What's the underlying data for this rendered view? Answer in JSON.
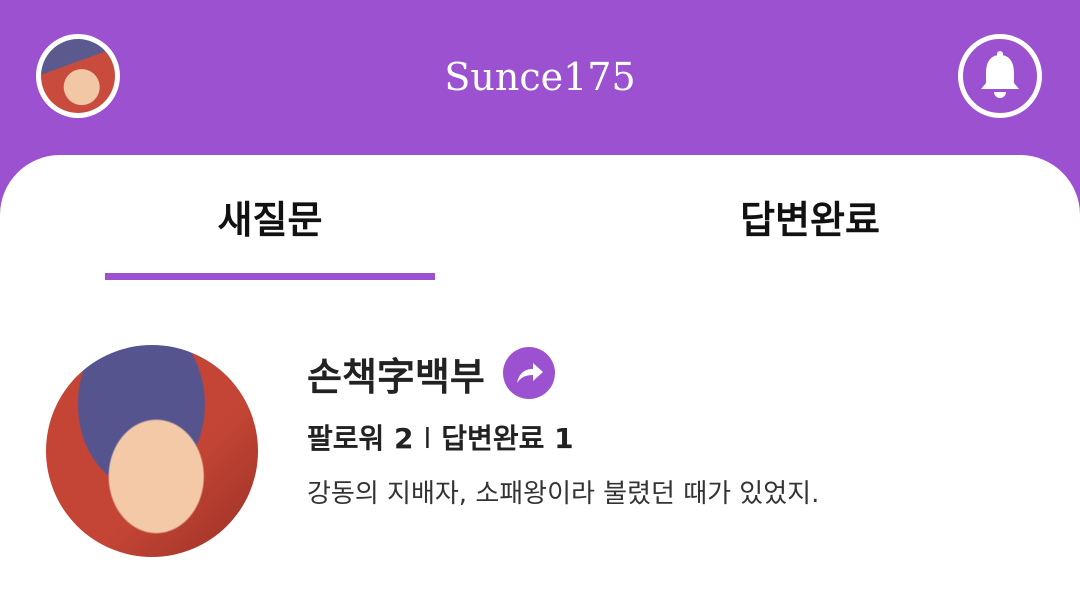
{
  "header": {
    "title": "Sunce175",
    "avatar_icon": "profile-thumbnail",
    "bell_icon": "bell-icon"
  },
  "colors": {
    "accent": "#9b51d0",
    "background": "#ffffff",
    "text": "#222222"
  },
  "tabs": [
    {
      "label": "새질문",
      "active": true
    },
    {
      "label": "답변완료",
      "active": false
    }
  ],
  "profile": {
    "name": "손책字백부",
    "share_icon": "share-arrow-icon",
    "followers_label": "팔로워",
    "followers_count": "2",
    "separator": "l",
    "answered_label": "답변완료",
    "answered_count": "1",
    "bio": "강동의 지배자, 소패왕이라 불렸던 때가 있었지."
  }
}
